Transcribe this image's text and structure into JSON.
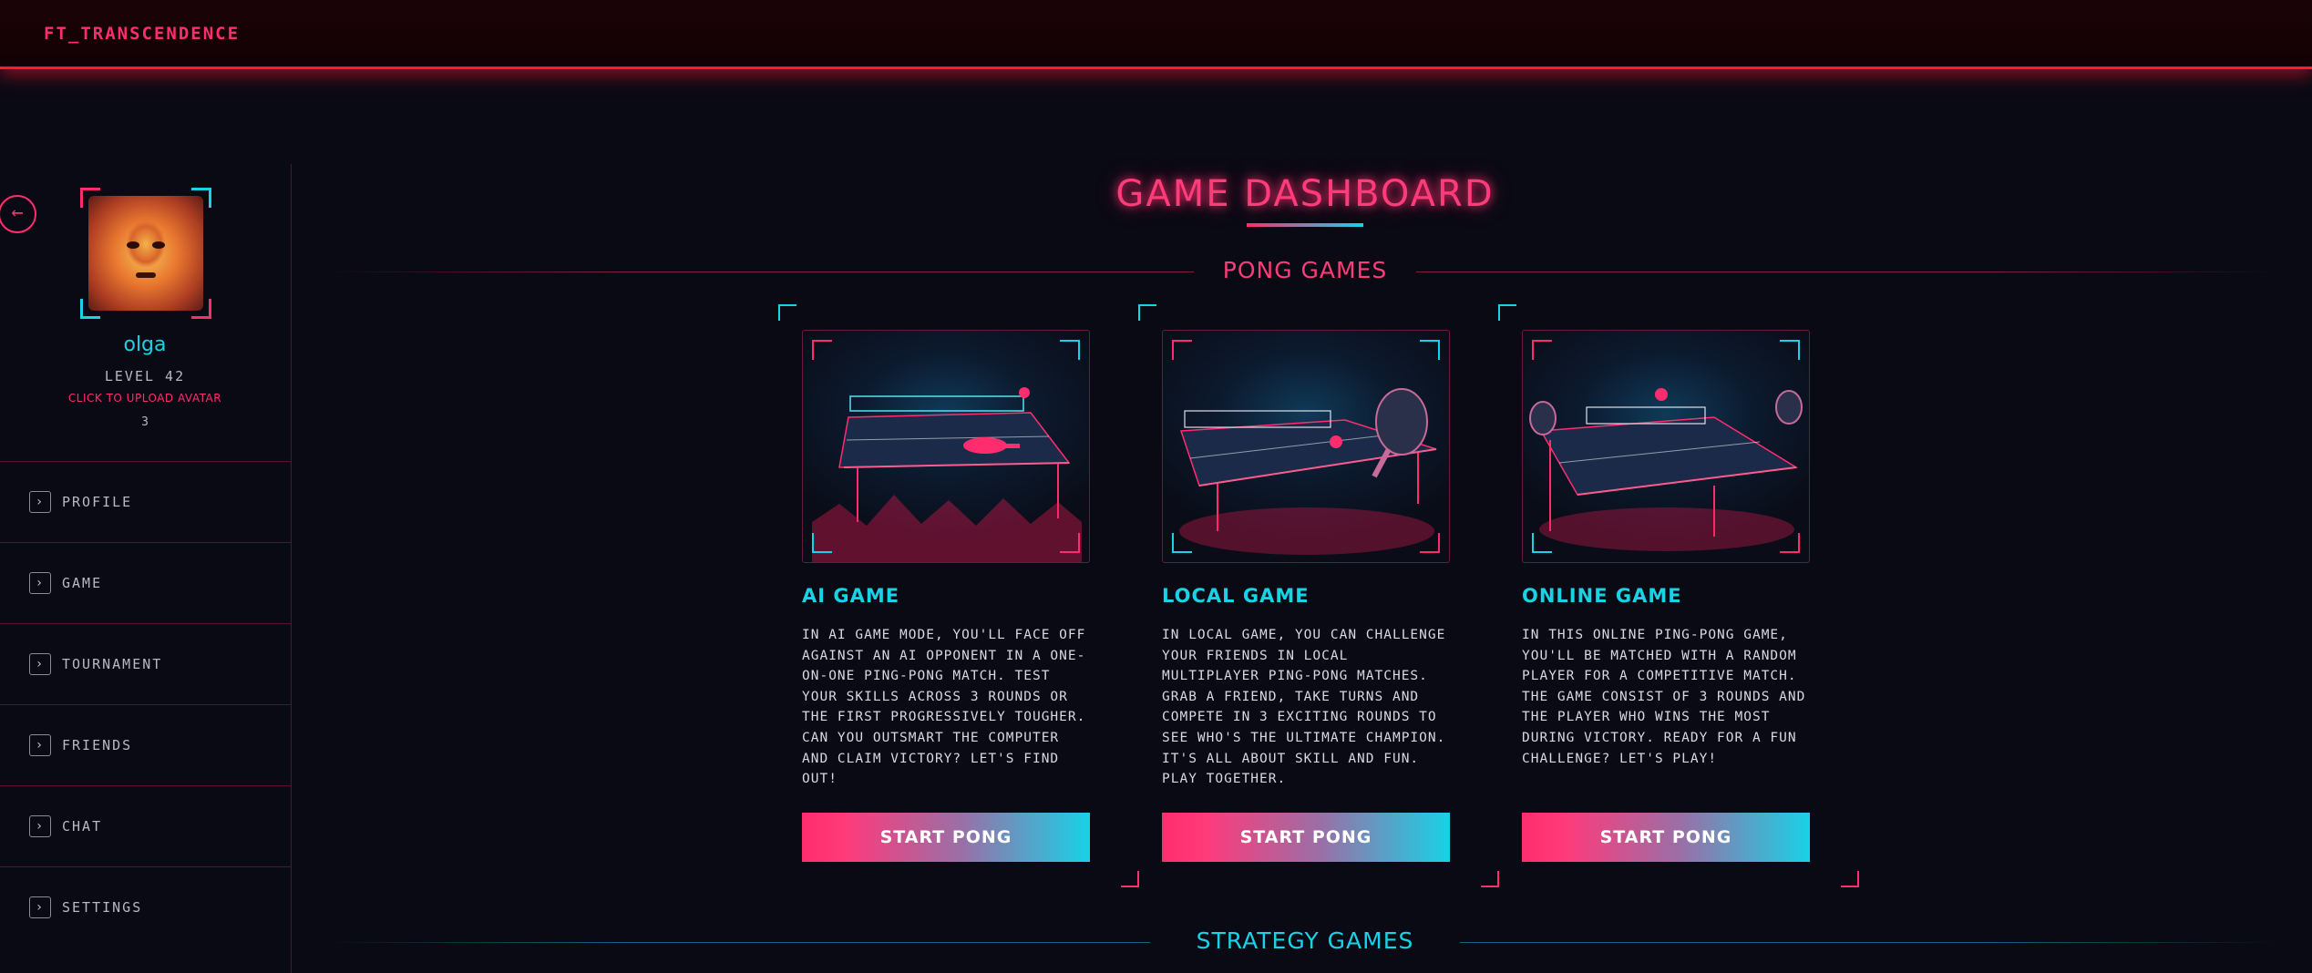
{
  "app": {
    "brand": "FT_TRANSCENDENCE"
  },
  "sidebar": {
    "username": "olga",
    "level": "LEVEL 42",
    "upload_label": "CLICK TO UPLOAD AVATAR",
    "count": "3",
    "items": [
      {
        "label": "PROFILE",
        "icon": "chevron-right-icon"
      },
      {
        "label": "GAME",
        "icon": "chevron-right-icon"
      },
      {
        "label": "TOURNAMENT",
        "icon": "chevron-right-icon"
      },
      {
        "label": "FRIENDS",
        "icon": "chevron-right-icon"
      },
      {
        "label": "CHAT",
        "icon": "chevron-right-icon"
      },
      {
        "label": "SETTINGS",
        "icon": "chevron-right-icon"
      }
    ]
  },
  "main": {
    "title": "GAME DASHBOARD",
    "pong_section": "PONG GAMES",
    "strategy_section": "STRATEGY GAMES",
    "cards": [
      {
        "title": "AI GAME",
        "description": "IN AI GAME MODE, YOU'LL FACE OFF\nAGAINST AN AI OPPONENT IN A ONE-\nON-ONE PING-PONG MATCH. TEST\nYOUR SKILLS ACROSS 3 ROUNDS OR\nTHE FIRST PROGRESSIVELY TOUGHER.\nCAN YOU OUTSMART THE COMPUTER\nAND CLAIM VICTORY? LET'S FIND\nOUT!",
        "button": "START PONG"
      },
      {
        "title": "LOCAL GAME",
        "description": "IN LOCAL GAME, YOU CAN CHALLENGE\nYOUR FRIENDS IN LOCAL\nMULTIPLAYER PING-PONG MATCHES.\nGRAB A FRIEND, TAKE TURNS AND\nCOMPETE IN 3 EXCITING ROUNDS TO\nSEE WHO'S THE ULTIMATE CHAMPION.\nIT'S ALL ABOUT SKILL AND FUN.\nPLAY TOGETHER.",
        "button": "START PONG"
      },
      {
        "title": "ONLINE GAME",
        "description": "IN THIS ONLINE PING-PONG GAME,\nYOU'LL BE MATCHED WITH A RANDOM\nPLAYER FOR A COMPETITIVE MATCH.\nTHE GAME CONSIST OF 3 ROUNDS AND\nTHE PLAYER WHO WINS THE MOST\nDURING VICTORY. READY FOR A FUN\nCHALLENGE? LET'S PLAY!",
        "button": "START PONG"
      }
    ]
  },
  "colors": {
    "accent_pink": "#ff2d6e",
    "accent_cyan": "#18d2e6",
    "header_red": "#ff1a2e",
    "background": "#0a0a14"
  }
}
